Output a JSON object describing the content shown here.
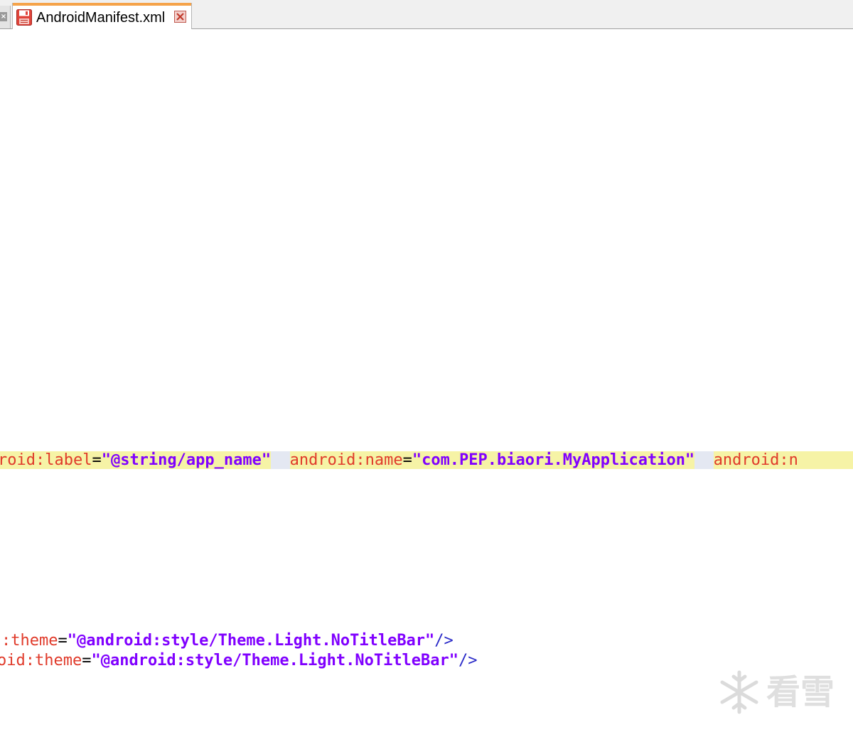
{
  "tabs": {
    "active_title": "AndroidManifest.xml",
    "prev_close_glyph": "×"
  },
  "editor": {
    "line1": {
      "attr1": "roid:label",
      "eq1": "=",
      "val1": "\"@string/app_name\"",
      "attr2": "android:name",
      "eq2": "=",
      "val2": "\"com.PEP.biaori.MyApplication\"",
      "attr3": "android:n"
    },
    "line2": {
      "attr": ":theme",
      "eq": "=",
      "val": "\"@android:style/Theme.Light.NoTitleBar\"",
      "end": "/>"
    },
    "line3": {
      "attr": "oid:theme",
      "eq": "=",
      "val": "\"@android:style/Theme.Light.NoTitleBar\"",
      "end": "/>"
    }
  },
  "watermark": {
    "text": "看雪"
  },
  "colors": {
    "tab_accent": "#f5a34a",
    "attribute": "#e03a2a",
    "value": "#8000ff",
    "highlight": "#f6f3a6"
  }
}
